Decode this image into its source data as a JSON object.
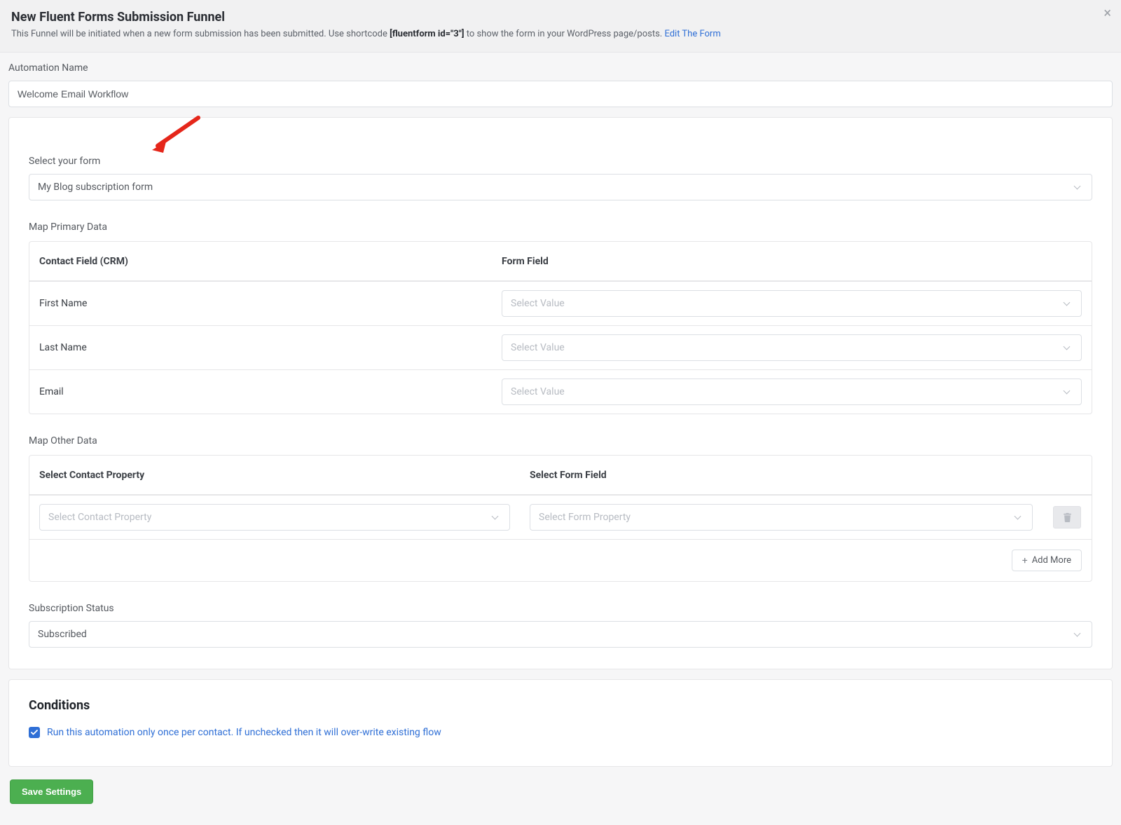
{
  "header": {
    "title": "New Fluent Forms Submission Funnel",
    "subtitle_before": "This Funnel will be initiated when a new form submission has been submitted. Use shortcode ",
    "shortcode": "[fluentform id=\"3\"]",
    "subtitle_after": " to show the form in your WordPress page/posts. ",
    "edit_link": "Edit The Form"
  },
  "automation": {
    "label": "Automation Name",
    "value": "Welcome Email Workflow"
  },
  "form_select": {
    "label": "Select your form",
    "value": "My Blog subscription form"
  },
  "map_primary": {
    "heading": "Map Primary Data",
    "col1": "Contact Field (CRM)",
    "col2": "Form Field",
    "select_placeholder": "Select Value",
    "rows": [
      "First Name",
      "Last Name",
      "Email"
    ]
  },
  "map_other": {
    "heading": "Map Other Data",
    "col1": "Select Contact Property",
    "col2": "Select Form Field",
    "contact_placeholder": "Select Contact Property",
    "form_placeholder": "Select Form Property",
    "add_more": "Add More"
  },
  "subscription": {
    "label": "Subscription Status",
    "value": "Subscribed"
  },
  "conditions": {
    "title": "Conditions",
    "run_once": "Run this automation only once per contact. If unchecked then it will over-write existing flow"
  },
  "footer": {
    "save": "Save Settings"
  }
}
